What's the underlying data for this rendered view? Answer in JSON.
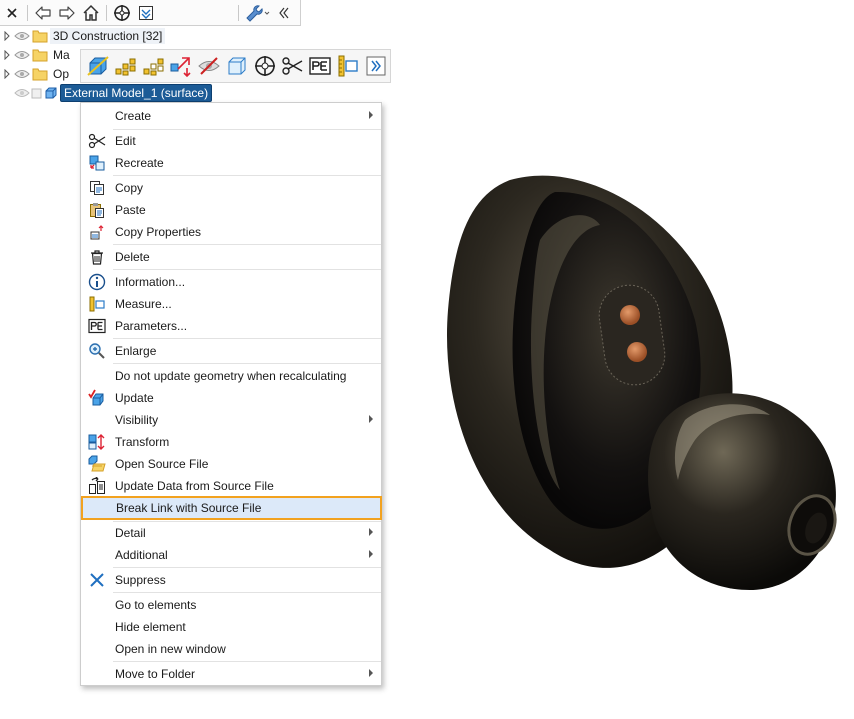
{
  "toolbar": {
    "icons": [
      "close-icon",
      "back-arrow-icon",
      "forward-arrow-icon",
      "home-icon",
      "target-icon",
      "filter-icon",
      "wrench-icon",
      "collapse-icon"
    ]
  },
  "tree": {
    "rows": [
      {
        "label": "3D Construction [32]"
      },
      {
        "label": "Ma"
      },
      {
        "label": "Op"
      },
      {
        "label": "External Model_1 (surface)"
      }
    ]
  },
  "menu": {
    "items": [
      {
        "label": "Create"
      },
      {
        "label": "Edit"
      },
      {
        "label": "Recreate"
      },
      {
        "label": "Copy"
      },
      {
        "label": "Paste"
      },
      {
        "label": "Copy Properties"
      },
      {
        "label": "Delete"
      },
      {
        "label": "Information..."
      },
      {
        "label": "Measure..."
      },
      {
        "label": "Parameters..."
      },
      {
        "label": "Enlarge"
      },
      {
        "label": "Do not update geometry when recalculating"
      },
      {
        "label": "Update"
      },
      {
        "label": "Visibility"
      },
      {
        "label": "Transform"
      },
      {
        "label": "Open Source File"
      },
      {
        "label": "Update Data from Source File"
      },
      {
        "label": "Break Link with Source File"
      },
      {
        "label": "Detail"
      },
      {
        "label": "Additional"
      },
      {
        "label": "Suppress"
      },
      {
        "label": "Go to elements"
      },
      {
        "label": "Hide element"
      },
      {
        "label": "Open in new window"
      },
      {
        "label": "Move to Folder"
      }
    ]
  },
  "colors": {
    "selection": "#1c5b96",
    "highlight_outline": "#f2a21f",
    "highlight_fill": "#dce9f9",
    "accent_blue": "#1f6fc0"
  }
}
